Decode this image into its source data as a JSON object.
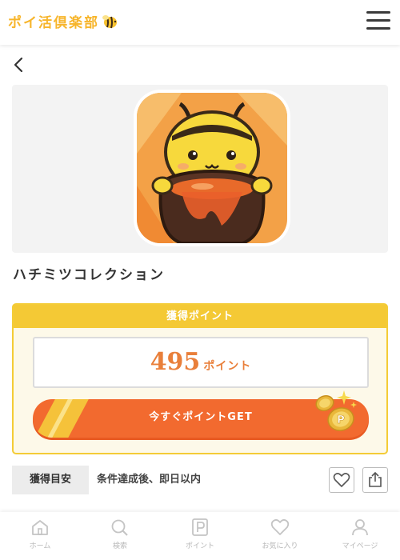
{
  "header": {
    "logo_text": "ポイ活倶楽部",
    "logo_icon": "bee-icon",
    "menu_icon": "hamburger-menu-icon"
  },
  "nav": {
    "back_icon": "chevron-left-icon"
  },
  "app": {
    "title": "ハチミツコレクション",
    "icon": "honey-bee-app-icon"
  },
  "points": {
    "header_label": "獲得ポイント",
    "value": "495",
    "unit": "ポイント",
    "get_button_label": "今すぐポイントGET",
    "coin_icon": "coin-p-icon"
  },
  "estimate": {
    "label": "獲得目安",
    "value": "条件達成後、即日以内"
  },
  "actions": {
    "favorite_icon": "heart-icon",
    "share_icon": "share-icon"
  },
  "footer": {
    "items": [
      {
        "label": "ホーム",
        "icon": "home-icon"
      },
      {
        "label": "検索",
        "icon": "search-icon"
      },
      {
        "label": "ポイント",
        "icon": "point-p-icon"
      },
      {
        "label": "お気に入り",
        "icon": "heart-icon"
      },
      {
        "label": "マイページ",
        "icon": "user-icon"
      }
    ]
  },
  "colors": {
    "accent_orange": "#f26a2f",
    "accent_yellow": "#f4c935",
    "point_text": "#e97f3a"
  }
}
